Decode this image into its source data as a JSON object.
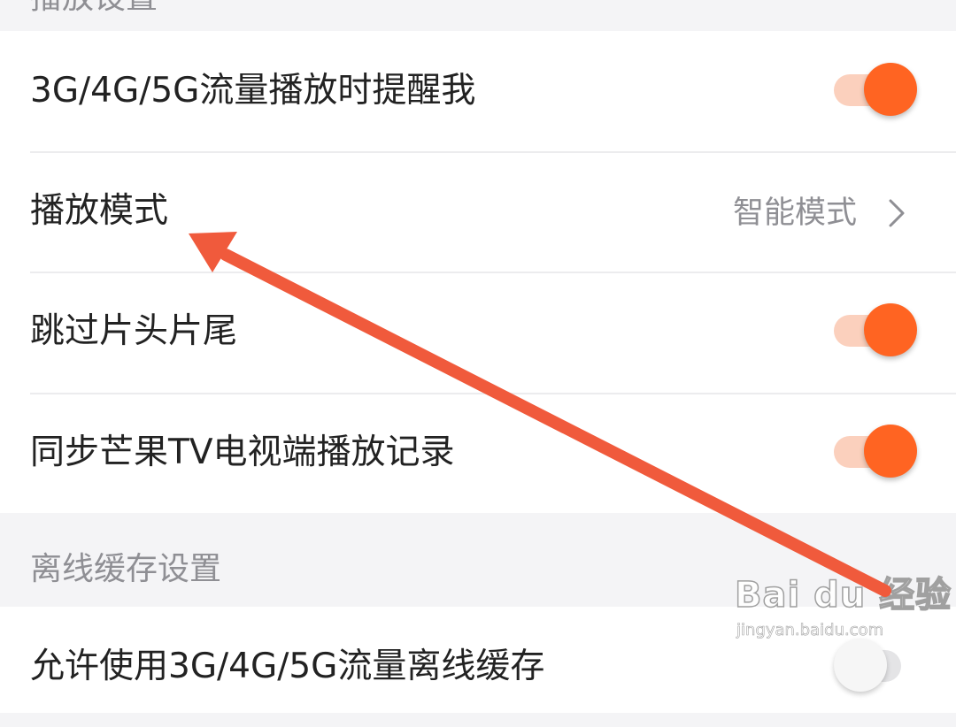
{
  "sections": {
    "playback": {
      "header": "播放设置",
      "rows": [
        {
          "label": "3G/4G/5G流量播放时提醒我",
          "control": "toggle",
          "on": true
        },
        {
          "label": "播放模式",
          "control": "value",
          "value": "智能模式",
          "icon": "chevron-right-icon"
        },
        {
          "label": "跳过片头片尾",
          "control": "toggle",
          "on": true
        },
        {
          "label": "同步芒果TV电视端播放记录",
          "control": "toggle",
          "on": true
        }
      ]
    },
    "offline": {
      "header": "离线缓存设置",
      "rows": [
        {
          "label": "允许使用3G/4G/5G流量离线缓存",
          "control": "toggle",
          "on": false
        }
      ]
    }
  },
  "watermark": {
    "logo": "Bai du 经验",
    "url": "jingyan.baidu.com"
  },
  "colors": {
    "accent": "#ff6422",
    "toggle_track_on": "#fbd0bd",
    "annotation_arrow": "#f05a3c",
    "section_bg": "#f4f4f6",
    "secondary_text": "#8f8f94"
  }
}
